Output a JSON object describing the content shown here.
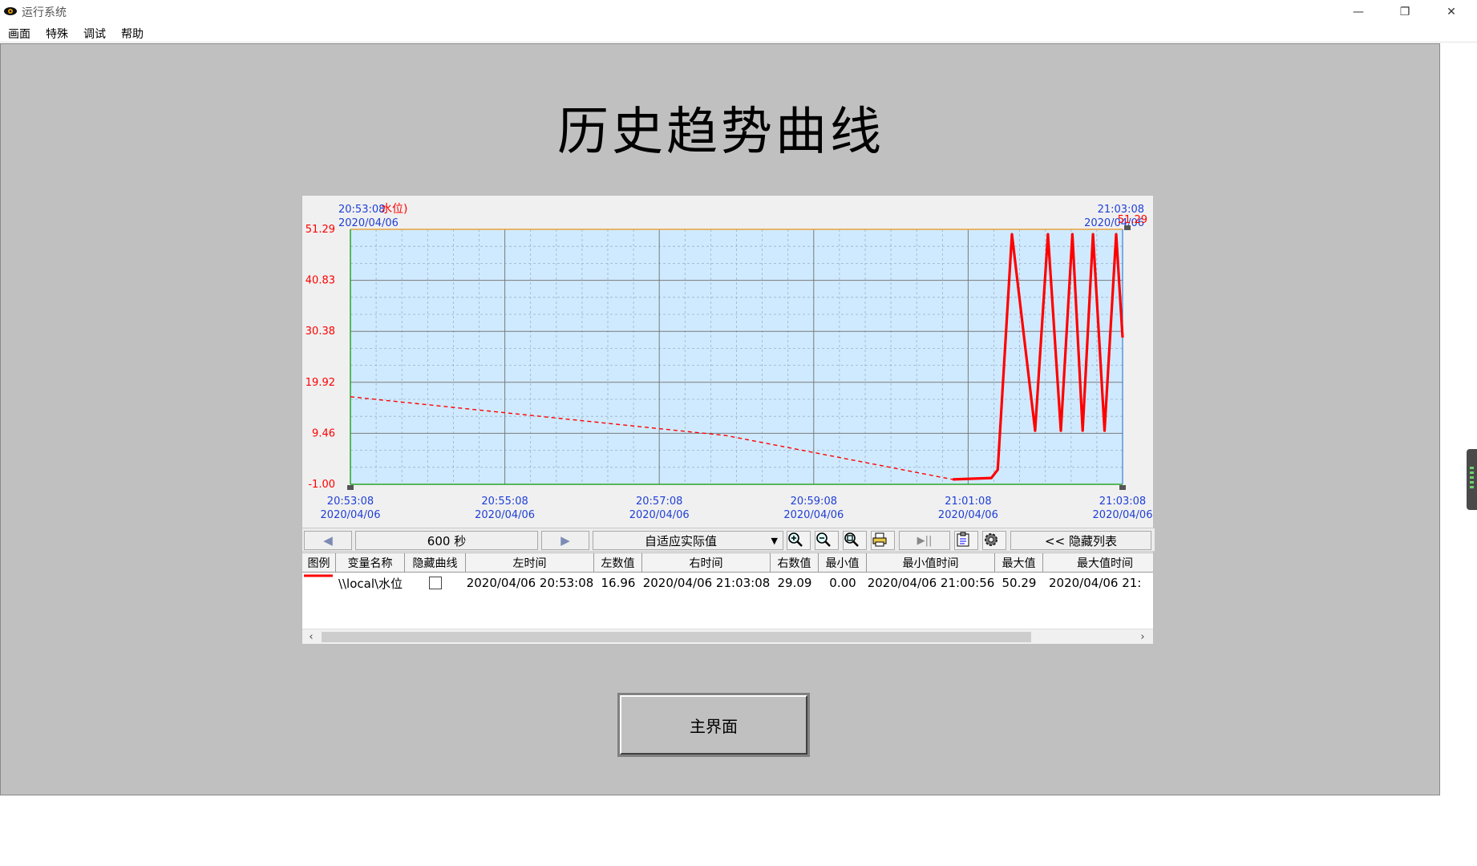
{
  "window": {
    "title": "运行系统",
    "minimize": "—",
    "restore": "❐",
    "close": "✕"
  },
  "menu": [
    "画面",
    "特殊",
    "调试",
    "帮助"
  ],
  "page": {
    "title": "历史趋势曲线"
  },
  "trend": {
    "top_left_time": "20:53:08",
    "top_left_date": "2020/04/06",
    "top_left_var": "水位)",
    "top_right_time": "21:03:08",
    "top_right_date": "2020/04/06",
    "top_right_value": "51.29",
    "y_ticks": [
      "51.29",
      "40.83",
      "30.38",
      "19.92",
      "9.46",
      "-1.00"
    ],
    "x_ticks": [
      {
        "time": "20:53:08",
        "date": "2020/04/06"
      },
      {
        "time": "20:55:08",
        "date": "2020/04/06"
      },
      {
        "time": "20:57:08",
        "date": "2020/04/06"
      },
      {
        "time": "20:59:08",
        "date": "2020/04/06"
      },
      {
        "time": "21:01:08",
        "date": "2020/04/06"
      },
      {
        "time": "21:03:08",
        "date": "2020/04/06"
      }
    ],
    "colors": {
      "plot_bg": "#cfeaff",
      "curve": "#ff0000",
      "axis_text": "#1f3fd6",
      "value_text": "#ff0000"
    }
  },
  "chart_data": {
    "type": "line",
    "xlabel": "",
    "ylabel": "",
    "x_range": [
      "2020/04/06 20:53:08",
      "2020/04/06 21:03:08"
    ],
    "ylim": [
      -1.0,
      51.29
    ],
    "grid": true,
    "series": [
      {
        "name": "\\\\local\\水位",
        "x": [
          "20:53:08",
          "20:58:00",
          "21:00:56",
          "21:01:26",
          "21:01:31",
          "21:01:42",
          "21:02:00",
          "21:02:10",
          "21:02:20",
          "21:02:29",
          "21:02:37",
          "21:02:45",
          "21:02:54",
          "21:03:03",
          "21:03:08"
        ],
        "y": [
          16.96,
          9.0,
          0.0,
          0.3,
          2.0,
          50.29,
          10.0,
          50.29,
          10.0,
          50.29,
          10.0,
          50.29,
          10.0,
          50.29,
          29.09
        ],
        "dashed_until": "21:00:56"
      }
    ]
  },
  "toolbar": {
    "prev": "◀",
    "span": "600  秒",
    "next": "▶",
    "mode": "自适应实际值",
    "dropdown": "▼",
    "hide_list": "<<  隐藏列表",
    "icons": [
      "zoom-in-icon",
      "zoom-out-icon",
      "zoom-fit-icon",
      "print-icon",
      "play-pause-icon",
      "clipboard-icon",
      "settings-icon"
    ]
  },
  "table": {
    "headers": [
      "图例",
      "变量名称",
      "隐藏曲线",
      "左时间",
      "左数值",
      "右时间",
      "右数值",
      "最小值",
      "最小值时间",
      "最大值",
      "最大值时间"
    ],
    "rows": [
      {
        "name": "\\\\local\\水位",
        "left_time": "2020/04/06 20:53:08",
        "left_value": "16.96",
        "right_time": "2020/04/06 21:03:08",
        "right_value": "29.09",
        "min": "0.00",
        "min_time": "2020/04/06 21:00:56",
        "max": "50.29",
        "max_time": "2020/04/06 21:"
      }
    ]
  },
  "buttons": {
    "main": "主界面"
  }
}
